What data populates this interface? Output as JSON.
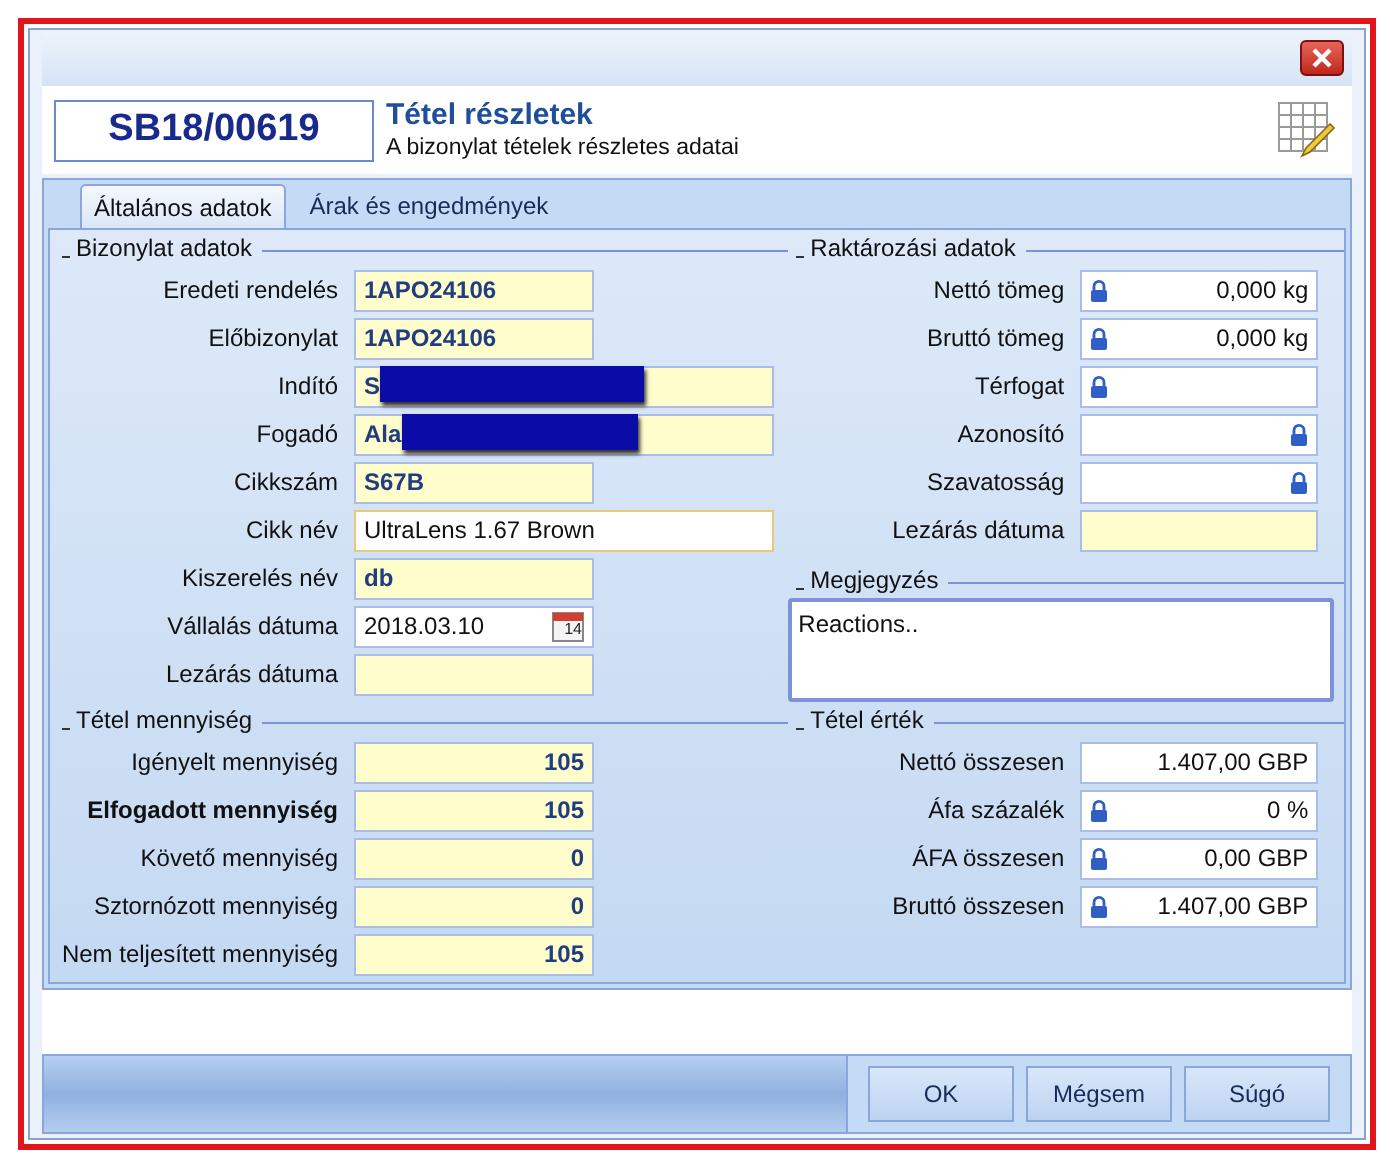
{
  "header": {
    "document_number": "SB18/00619",
    "title": "Tétel részletek",
    "subtitle": "A bizonylat tételek részletes adatai"
  },
  "tabs": [
    {
      "label": "Általános adatok",
      "selected": true
    },
    {
      "label": "Árak és engedmények",
      "selected": false
    }
  ],
  "bizonylat_adatok": {
    "heading": "Bizonylat adatok",
    "fields": [
      {
        "label": "Eredeti rendelés",
        "value": "1APO24106",
        "kind": "readonly",
        "wide": false
      },
      {
        "label": "Előbizonylat",
        "value": "1APO24106",
        "kind": "readonly",
        "wide": false
      },
      {
        "label": "Indító",
        "value": "S",
        "kind": "readonly",
        "wide": true,
        "redacted": true
      },
      {
        "label": "Fogadó",
        "value": "Ala",
        "kind": "readonly",
        "wide": true,
        "redacted": true
      },
      {
        "label": "Cikkszám",
        "value": "S67B",
        "kind": "readonly",
        "wide": false
      },
      {
        "label": "Cikk név",
        "value": "UltraLens 1.67 Brown",
        "kind": "text",
        "wide": true
      },
      {
        "label": "Kiszerelés név",
        "value": "db",
        "kind": "readonly",
        "wide": false
      },
      {
        "label": "Vállalás dátuma",
        "value": "2018.03.10",
        "kind": "date",
        "wide": false,
        "calendar_day": "14"
      },
      {
        "label": "Lezárás dátuma",
        "kind": "readonly",
        "wide": false
      }
    ]
  },
  "raktarozasi_adatok": {
    "heading": "Raktározási adatok",
    "fields": [
      {
        "label": "Nettó tömeg",
        "value": "0,000 kg",
        "kind": "text",
        "locked": true,
        "lock_at_end": false
      },
      {
        "label": "Bruttó tömeg",
        "value": "0,000 kg",
        "kind": "text",
        "locked": true,
        "lock_at_end": false
      },
      {
        "label": "Térfogat",
        "kind": "text",
        "locked": true,
        "lock_at_end": false
      },
      {
        "label": "Azonosító",
        "kind": "text",
        "locked": true,
        "lock_at_end": true
      },
      {
        "label": "Szavatosság",
        "kind": "text",
        "locked": true,
        "lock_at_end": true
      },
      {
        "label": "Lezárás dátuma",
        "kind": "readonly"
      }
    ]
  },
  "megjegyzes": {
    "heading": "Megjegyzés",
    "value": "Reactions.."
  },
  "tetel_mennyiseg": {
    "heading": "Tétel mennyiség",
    "fields": [
      {
        "label": "Igényelt mennyiség",
        "value": "105",
        "kind": "readonly",
        "bold_label": false
      },
      {
        "label": "Elfogadott mennyiség",
        "value": "105",
        "kind": "readonly",
        "bold_label": true
      },
      {
        "label": "Követő mennyiség",
        "value": "0",
        "kind": "readonly",
        "bold_label": false
      },
      {
        "label": "Sztornózott mennyiség",
        "value": "0",
        "kind": "readonly",
        "bold_label": false
      },
      {
        "label": "Nem teljesített mennyiség",
        "value": "105",
        "kind": "readonly",
        "bold_label": false
      }
    ]
  },
  "tetel_ertek": {
    "heading": "Tétel érték",
    "fields": [
      {
        "label": "Nettó összesen",
        "value": "1.407,00 GBP",
        "kind": "text",
        "locked": false
      },
      {
        "label": "Áfa százalék",
        "value": "0 %",
        "kind": "text",
        "locked": true,
        "lock_at_end": false
      },
      {
        "label": "ÁFA összesen",
        "value": "0,00 GBP",
        "kind": "text",
        "locked": true,
        "lock_at_end": false
      },
      {
        "label": "Bruttó összesen",
        "value": "1.407,00 GBP",
        "kind": "text",
        "locked": true,
        "lock_at_end": false
      }
    ]
  },
  "buttons": [
    "OK",
    "Mégsem",
    "Súgó"
  ]
}
